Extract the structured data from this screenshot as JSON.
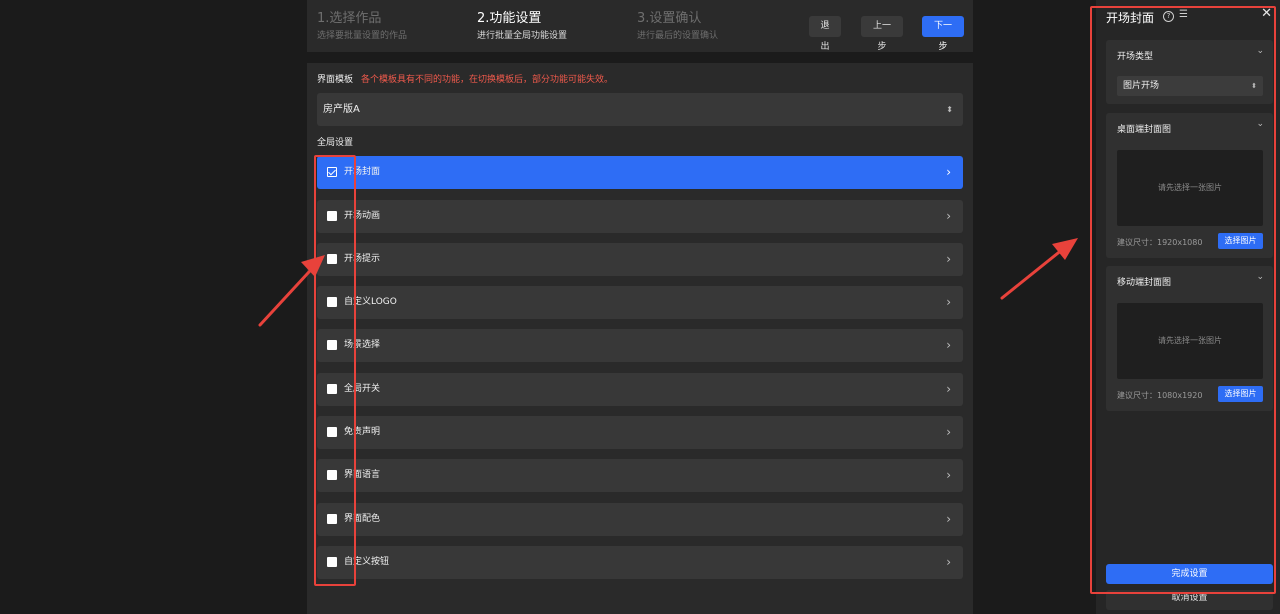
{
  "steps": [
    {
      "title": "1.选择作品",
      "subtitle": "选择要批量设置的作品"
    },
    {
      "title": "2.功能设置",
      "subtitle": "进行批量全局功能设置"
    },
    {
      "title": "3.设置确认",
      "subtitle": "进行最后的设置确认"
    }
  ],
  "toolbar": {
    "exit": "退出",
    "prev": "上一步",
    "next": "下一步"
  },
  "template": {
    "label": "界面模板",
    "warning": "各个模板具有不同的功能，在切换模板后，部分功能可能失效。",
    "value": "房产版A"
  },
  "global_label": "全局设置",
  "features": [
    {
      "label": "开场封面",
      "checked": true
    },
    {
      "label": "开场动画",
      "checked": false
    },
    {
      "label": "开场提示",
      "checked": false
    },
    {
      "label": "自定义LOGO",
      "checked": false
    },
    {
      "label": "场景选择",
      "checked": false
    },
    {
      "label": "全局开关",
      "checked": false
    },
    {
      "label": "免责声明",
      "checked": false
    },
    {
      "label": "界面语言",
      "checked": false
    },
    {
      "label": "界面配色",
      "checked": false
    },
    {
      "label": "自定义按钮",
      "checked": false
    }
  ],
  "right_panel": {
    "title": "开场封面",
    "type_card": {
      "header": "开场类型",
      "value": "图片开场"
    },
    "desktop_card": {
      "header": "桌面端封面图",
      "placeholder": "请先选择一张图片",
      "size": "建议尺寸：1920x1080",
      "button": "选择图片"
    },
    "mobile_card": {
      "header": "移动端封面图",
      "placeholder": "请先选择一张图片",
      "size": "建议尺寸：1080x1920",
      "button": "选择图片"
    },
    "done": "完成设置",
    "cancel": "取消设置"
  },
  "colors": {
    "accent": "#2e6df5",
    "annotation": "#e8423b",
    "warning": "#f05a4c"
  }
}
